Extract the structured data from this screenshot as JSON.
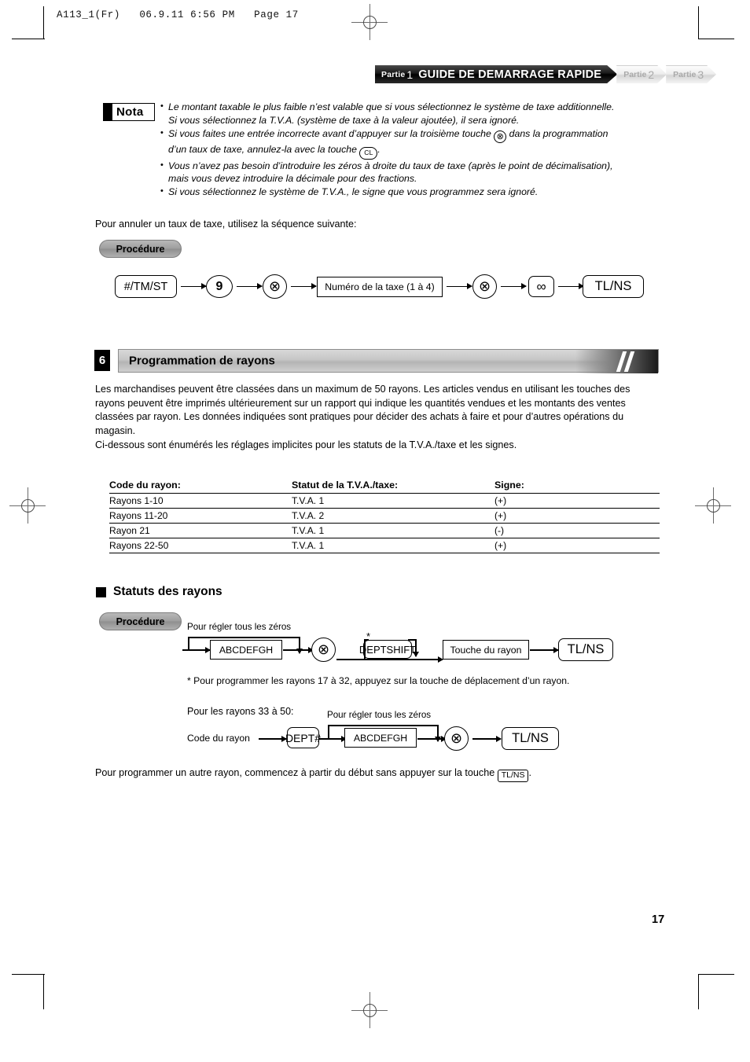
{
  "file_header": "A113_1(Fr)   06.9.11 6:56 PM   Page 17",
  "banner": {
    "part1_label": "Partie",
    "part1_num": "1",
    "part1_title": "GUIDE DE DEMARRAGE RAPIDE",
    "part2_label": "Partie",
    "part2_num": "2",
    "part3_label": "Partie",
    "part3_num": "3"
  },
  "nota": {
    "badge": "Nota",
    "items": [
      {
        "seg1": "Le montant taxable le plus faible n’est valable que si vous sélectionnez le système de taxe additionnelle. Si vous sélectionnez la T.V.A. (système de taxe à la valeur ajoutée), il sera ignoré."
      },
      {
        "seg1": "Si vous faites une entrée incorrecte avant d’appuyer sur la troisième touche",
        "key1": "⊗",
        "seg2": "dans la programmation d’un taux de taxe, annulez-la avec la touche",
        "key2": "CL",
        "seg3": "."
      },
      {
        "seg1": "Vous n’avez pas besoin d’introduire les zéros à droite du taux de taxe (après le point de décimalisation), mais vous devez introduire la décimale pour des fractions."
      },
      {
        "seg1": "Si vous sélectionnez le système de T.V.A., le signe que vous programmez sera ignoré."
      }
    ]
  },
  "intro_line": "Pour annuler un taux de taxe, utilisez la séquence suivante:",
  "procedure_label": "Procédure",
  "flow_tax_cancel": {
    "k1": "#/TM/ST",
    "k2": "9",
    "k3": "⊗",
    "k4": "Numéro de la taxe (1 à 4)",
    "k5": "⊗",
    "k6": "∞",
    "k7": "TL/NS"
  },
  "section6": {
    "number": "6",
    "title": "Programmation de rayons",
    "paragraph": "Les marchandises peuvent être classées dans un maximum de 50 rayons. Les articles vendus en utilisant les touches des rayons peuvent être imprimés ultérieurement sur un rapport qui indique les quantités vendues et les montants des ventes classées par rayon. Les données indiquées sont pratiques pour décider des achats à faire et pour d’autres opérations du magasin.",
    "paragraph2": "Ci-dessous sont énumérés les réglages implicites pour les statuts de la T.V.A./taxe et les signes."
  },
  "table": {
    "headers": [
      "Code du rayon:",
      "Statut de la T.V.A./taxe:",
      "Signe:"
    ],
    "rows": [
      [
        "Rayons 1-10",
        "T.V.A. 1",
        "(+)"
      ],
      [
        "Rayons 11-20",
        "T.V.A. 2",
        "(+)"
      ],
      [
        "Rayon 21",
        "T.V.A. 1",
        "(-)"
      ],
      [
        "Rayons 22-50",
        "T.V.A. 1",
        "(+)"
      ]
    ]
  },
  "subsection": {
    "title": "Statuts des rayons",
    "procedure_label": "Procédure"
  },
  "flow_dept_status": {
    "zero_caption": "Pour régler tous les zéros",
    "k1": "ABCDEFGH",
    "k2": "⊗",
    "star": "*",
    "k3": "DEPTSHIFT",
    "k4": "Touche du rayon",
    "k5": "TL/NS"
  },
  "footnote": "* Pour programmer les rayons 17 à 32, appuyez sur la touche de déplacement d’un rayon.",
  "flow_dept_3350": {
    "heading": "Pour les rayons 33 à 50:",
    "zero_caption": "Pour régler tous les zéros",
    "left_label": "Code du rayon",
    "k1": "DEPT#",
    "k2": "ABCDEFGH",
    "k3": "⊗",
    "k4": "TL/NS"
  },
  "closing": {
    "seg1": "Pour programmer un autre rayon, commencez à partir du début sans appuyer sur la touche",
    "key": "TL/NS",
    "seg2": "."
  },
  "page_number": "17"
}
